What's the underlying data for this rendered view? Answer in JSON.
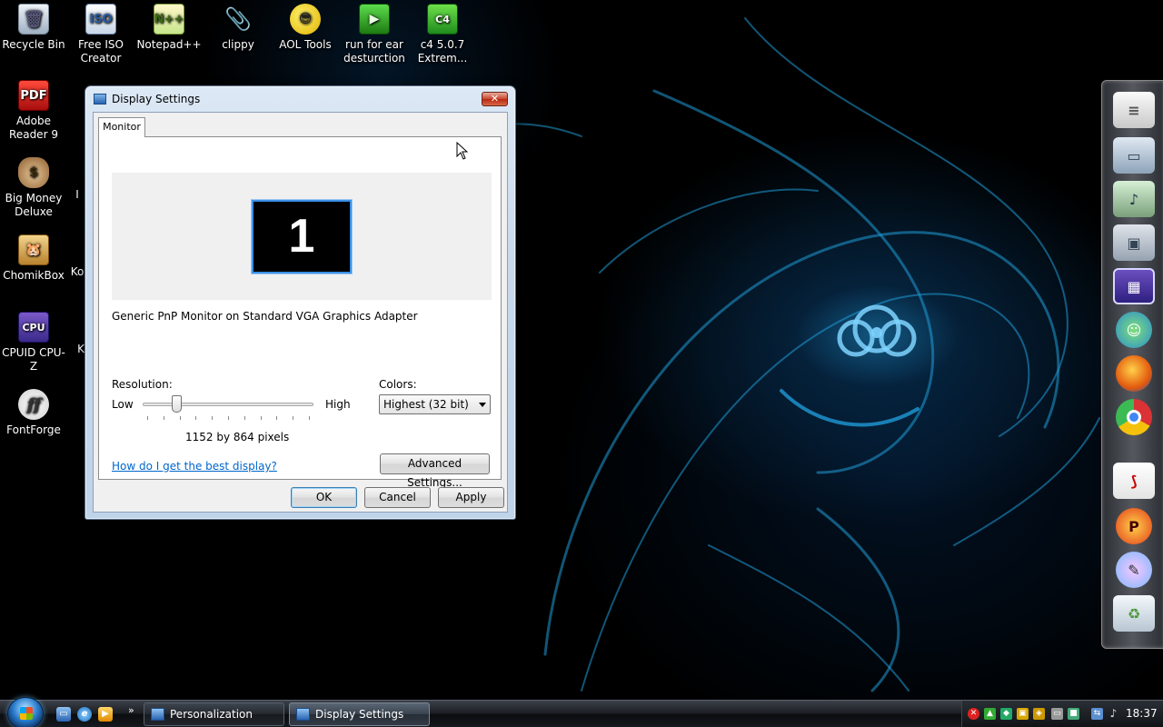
{
  "desktop": {
    "icons": [
      {
        "label": "Recycle Bin",
        "glyph": "🗑",
        "icon": "recycle-bin-icon"
      },
      {
        "label": "Free ISO Creator",
        "glyph": "ISO",
        "icon": "iso-creator-icon"
      },
      {
        "label": "Notepad++",
        "glyph": "N++",
        "icon": "notepad-plus-plus-icon"
      },
      {
        "label": "clippy",
        "glyph": "📎",
        "icon": "clippy-icon"
      },
      {
        "label": "AOL Tools",
        "glyph": "😎",
        "icon": "aol-tools-icon"
      },
      {
        "label": "run for ear desturction",
        "glyph": "▶",
        "icon": "run-for-ear-icon"
      },
      {
        "label": "c4 5.0.7 Extrem...",
        "glyph": "C4",
        "icon": "c4-icon"
      },
      {
        "label": "Adobe Reader 9",
        "glyph": "PDF",
        "icon": "adobe-reader-icon"
      },
      {
        "label": "Big Money Deluxe",
        "glyph": "$",
        "icon": "big-money-icon"
      },
      {
        "label": "ChomikBox",
        "glyph": "🐹",
        "icon": "chomikbox-icon"
      },
      {
        "label": "CPUID CPU-Z",
        "glyph": "CPU",
        "icon": "cpu-z-icon"
      },
      {
        "label": "FontForge",
        "glyph": "ff",
        "icon": "fontforge-icon"
      }
    ],
    "partial_labels": [
      "I",
      "Ko",
      "K"
    ]
  },
  "dialog": {
    "title": "Display Settings",
    "close_glyph": "✕",
    "tab_monitor": "Monitor",
    "monitor_number": "1",
    "adapter": "Generic PnP Monitor on Standard VGA Graphics Adapter",
    "resolution_label": "Resolution:",
    "low_label": "Low",
    "high_label": "High",
    "resolution_value": "1152 by 864 pixels",
    "slider_position": 0.18,
    "slider_ticks": 11,
    "colors_label": "Colors:",
    "colors_value": "Highest (32 bit)",
    "help_link": "How do I get the best display?",
    "advanced_button": "Advanced Settings...",
    "ok_button": "OK",
    "cancel_button": "Cancel",
    "apply_button": "Apply"
  },
  "taskbar": {
    "quick_more": "»",
    "tasks": [
      {
        "label": "Personalization",
        "active": false
      },
      {
        "label": "Display Settings",
        "active": true
      }
    ],
    "clock": "18:37"
  },
  "colors": {
    "link": "#0066cc",
    "monitor_border": "#3a8fe6",
    "close_button": "#c8462c",
    "wallpaper_glow": "#28aae6"
  }
}
